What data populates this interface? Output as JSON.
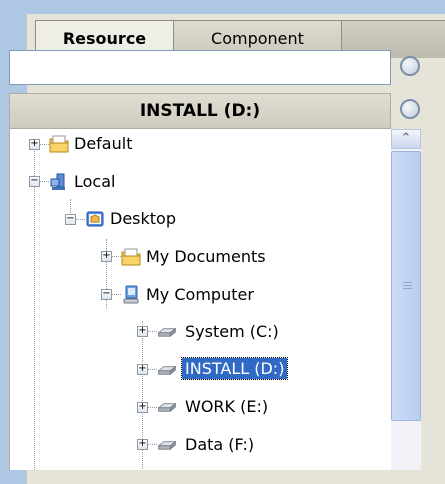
{
  "tabs": [
    {
      "label": "Resource",
      "active": true
    },
    {
      "label": "Component",
      "active": false
    }
  ],
  "search": {
    "value": "",
    "placeholder": ""
  },
  "current_location": "INSTALL (D:)",
  "tree": {
    "default": {
      "label": "Default",
      "expanded": false,
      "icon": "folder-icon"
    },
    "local": {
      "label": "Local",
      "expanded": true,
      "icon": "network-icon"
    },
    "desktop": {
      "label": "Desktop",
      "expanded": true,
      "icon": "desktop-icon"
    },
    "my_documents": {
      "label": "My Documents",
      "expanded": false,
      "icon": "folder-icon"
    },
    "my_computer": {
      "label": "My Computer",
      "expanded": true,
      "icon": "computer-icon"
    },
    "drives": [
      {
        "label": "System (C:)",
        "expanded": false,
        "selected": false,
        "icon": "drive-icon"
      },
      {
        "label": "INSTALL (D:)",
        "expanded": false,
        "selected": true,
        "icon": "drive-icon"
      },
      {
        "label": "WORK (E:)",
        "expanded": false,
        "selected": false,
        "icon": "drive-icon"
      },
      {
        "label": "Data (F:)",
        "expanded": false,
        "selected": false,
        "icon": "drive-icon"
      }
    ]
  },
  "colors": {
    "selection": "#316ac5",
    "background": "#aec7e3",
    "panel": "#e6e4d8"
  }
}
